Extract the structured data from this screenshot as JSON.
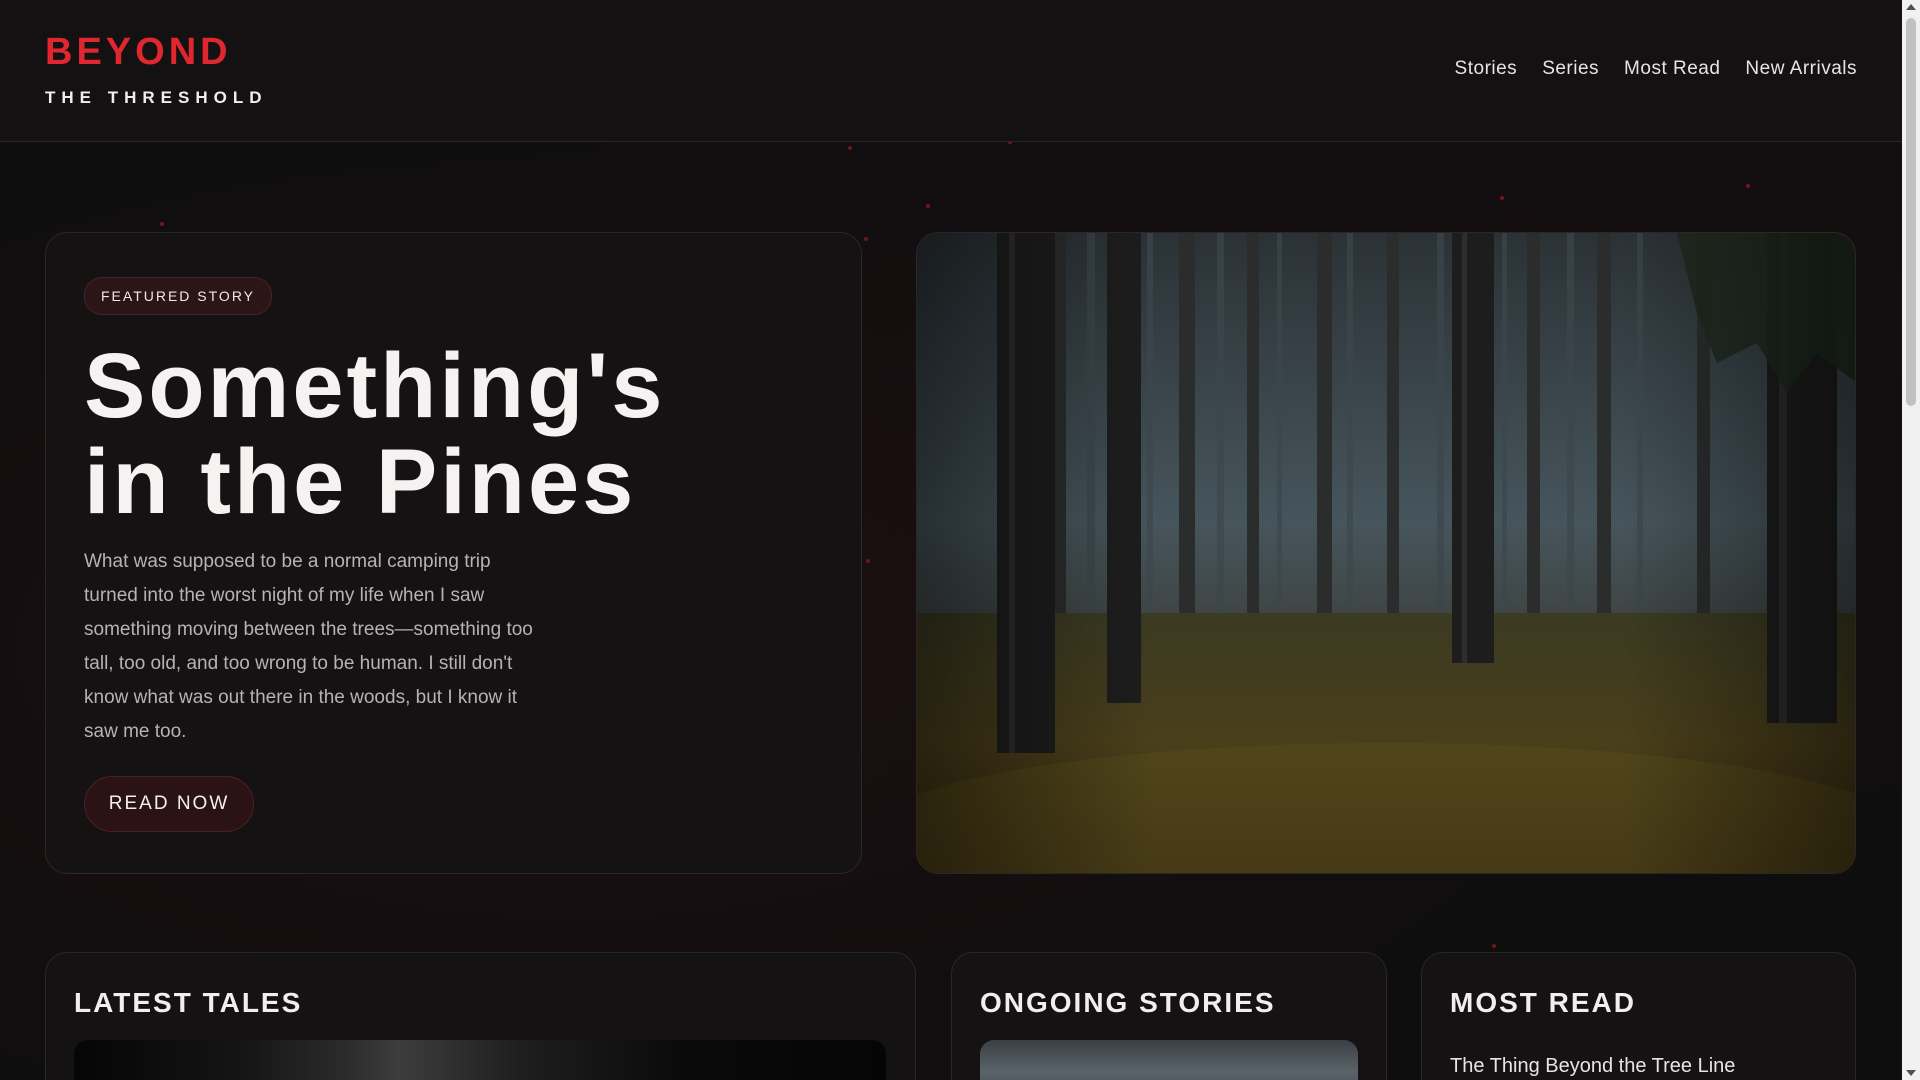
{
  "site": {
    "logo_main": "BEYOND",
    "logo_sub": "THE THRESHOLD",
    "accent_color": "#e0262e"
  },
  "nav": {
    "items": [
      "Stories",
      "Series",
      "Most Read",
      "New Arrivals"
    ]
  },
  "hero": {
    "badge": "FEATURED STORY",
    "title_line1": "Something's",
    "title_line2": "in the Pines",
    "description": "What was supposed to be a normal camping trip turned into the worst night of my life when I saw something moving between the trees—something too tall, too old, and too wrong to be human. I still don't know what was out there in the woods, but I know it saw me too.",
    "button_label": "READ NOW",
    "image_icon": "foggy-forest-image"
  },
  "sections": {
    "latest": {
      "heading": "LATEST TALES"
    },
    "ongoing": {
      "heading": "ONGOING STORIES"
    },
    "most_read": {
      "heading": "MOST READ",
      "items": [
        "The Thing Beyond the Tree Line"
      ]
    }
  }
}
